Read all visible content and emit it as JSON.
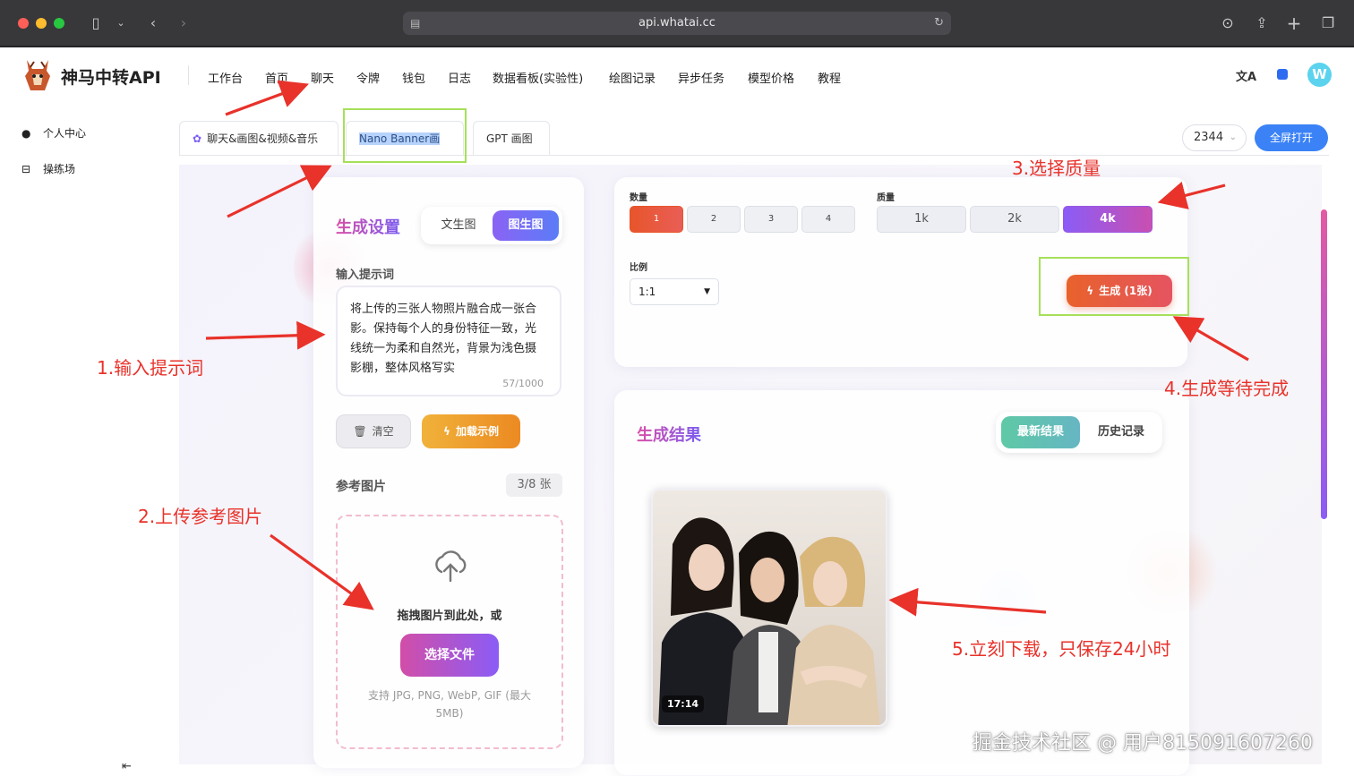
{
  "browser": {
    "url": "api.whatai.cc"
  },
  "header": {
    "brand": "神马中转API",
    "nav": [
      "工作台",
      "首页",
      "聊天",
      "令牌",
      "钱包",
      "日志",
      "数据看板(实验性)",
      "绘图记录",
      "异步任务",
      "模型价格",
      "教程"
    ],
    "avatar_letter": "W"
  },
  "sidebar": {
    "items": [
      {
        "label": "个人中心"
      },
      {
        "label": "操练场"
      }
    ]
  },
  "tabs": [
    {
      "label": "聊天&画图&视频&音乐"
    },
    {
      "label": "Nano Banner画图"
    },
    {
      "label": "GPT 画图"
    }
  ],
  "toolbar": {
    "select_value": "2344",
    "fullscreen_label": "全屏打开"
  },
  "settings": {
    "title": "生成设置",
    "mode_text2img": "文生图",
    "mode_img2img": "图生图",
    "prompt_label": "输入提示词",
    "prompt_value": "将上传的三张人物照片融合成一张合影。保持每个人的身份特征一致，光线统一为柔和自然光，背景为浅色摄影棚，整体风格写实",
    "prompt_count": "57/1000",
    "clear_label": "清空",
    "example_label": "加载示例",
    "ref_label": "参考图片",
    "ref_count": "3/8 张",
    "drop_text": "拖拽图片到此处，或",
    "choose_file": "选择文件",
    "support_text": "支持 JPG, PNG, WebP, GIF (最大 5MB)"
  },
  "options": {
    "count_label": "数量",
    "counts": [
      "1",
      "2",
      "3",
      "4"
    ],
    "count_selected": "1",
    "quality_label": "质量",
    "qualities": [
      "1k",
      "2k",
      "4k"
    ],
    "quality_selected": "4k",
    "ratio_label": "比例",
    "ratio_value": "1:1",
    "generate_label": "生成 (1张)"
  },
  "result": {
    "title": "生成结果",
    "tab_latest": "最新结果",
    "tab_history": "历史记录",
    "image_time": "17:14"
  },
  "annotations": {
    "step1": "1.输入提示词",
    "step2": "2.上传参考图片",
    "step3": "3.选择质量",
    "step4": "4.生成等待完成",
    "step5": "5.立刻下载，只保存24小时",
    "color": "#e8322a",
    "highlight_color": "#a6e05a"
  },
  "watermark": "掘金技术社区 @ 用户815091607260",
  "colors": {
    "primary": "#3b82f6",
    "accent_gradient_start": "#d94fa8",
    "accent_gradient_end": "#7b5cf0",
    "generate": "#e8562f"
  }
}
